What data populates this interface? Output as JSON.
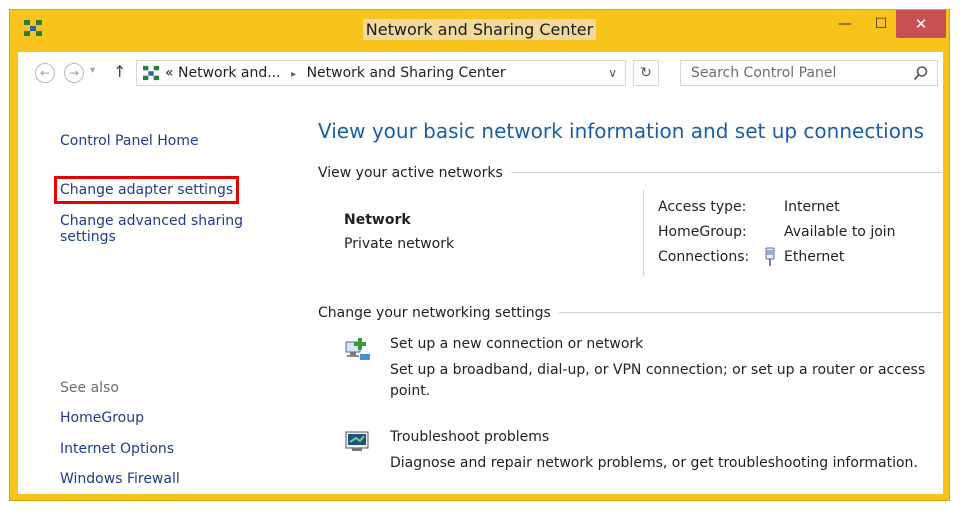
{
  "window": {
    "title": "Network and Sharing Center",
    "controls": {
      "minimize": "—",
      "maximize": "☐",
      "close": "✕"
    }
  },
  "navbar": {
    "back_icon": "←",
    "forward_icon": "→",
    "recent_icon": "▾",
    "up_icon": "↑",
    "breadcrumb": {
      "prefix": "«",
      "items": [
        "Network and...",
        "Network and Sharing Center"
      ],
      "separator": "▸"
    },
    "dropdown_icon": "∨",
    "refresh_icon": "↻",
    "search_placeholder": "Search Control Panel"
  },
  "sidebar": {
    "links": [
      "Control Panel Home",
      "Change adapter settings",
      "Change advanced sharing",
      "settings"
    ],
    "see_also_heading": "See also",
    "see_also": [
      "HomeGroup",
      "Internet Options",
      "Windows Firewall"
    ]
  },
  "main": {
    "title": "View your basic network information and set up connections",
    "active_networks_heading": "View your active networks",
    "network": {
      "name": "Network",
      "type": "Private network",
      "access_type_label": "Access type:",
      "access_type_value": "Internet",
      "homegroup_label": "HomeGroup:",
      "homegroup_value": "Available to join",
      "connections_label": "Connections:",
      "connections_value": "Ethernet"
    },
    "change_settings_heading": "Change your networking settings",
    "tasks": [
      {
        "title": "Set up a new connection or network",
        "desc1": "Set up a broadband, dial-up, or VPN connection; or set up a router or access",
        "desc2": "point."
      },
      {
        "title": "Troubleshoot problems",
        "desc1": "Diagnose and repair network problems, or get troubleshooting information."
      }
    ]
  },
  "colors": {
    "frame": "#f8c41c",
    "link": "#1c6bb5",
    "highlight": "#e60000",
    "close": "#c75050"
  }
}
